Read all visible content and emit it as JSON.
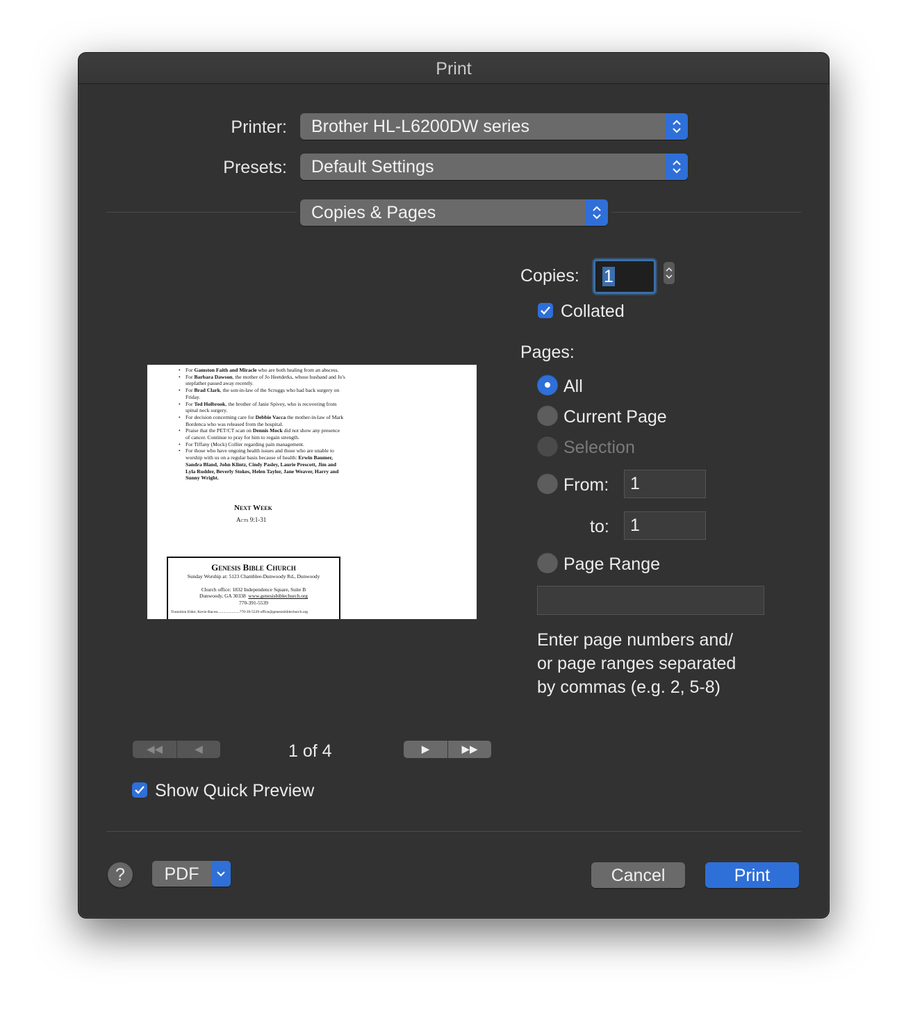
{
  "window": {
    "title": "Print"
  },
  "printer": {
    "label": "Printer:",
    "value": "Brother HL-L6200DW series"
  },
  "presets": {
    "label": "Presets:",
    "value": "Default Settings"
  },
  "section": {
    "value": "Copies & Pages"
  },
  "copies": {
    "label": "Copies:",
    "value": "1",
    "collated_label": "Collated",
    "collated_checked": true
  },
  "pages": {
    "label": "Pages:",
    "options": {
      "all": "All",
      "current": "Current Page",
      "selection": "Selection",
      "from": "From:",
      "page_range": "Page Range"
    },
    "selected": "All",
    "from_value": "1",
    "to_label": "to:",
    "to_value": "1",
    "range_value": "",
    "help_line1": "Enter page numbers and/",
    "help_line2": "or page ranges separated",
    "help_line3": "by commas (e.g. 2, 5-8)"
  },
  "preview": {
    "bullets": [
      {
        "pre": "For ",
        "bold": "Gamston Faith and Miracle",
        "post": " who are both healing from an abscess."
      },
      {
        "pre": "For ",
        "bold": "Barbara Dawson",
        "post": ", the mother of Jo Heetderks, whose husband and Jo's stepfather passed away recently."
      },
      {
        "pre": "For ",
        "bold": "Brad Clark",
        "post": ", the son-in-law of the Scruggs who had back surgery on Friday."
      },
      {
        "pre": "For ",
        "bold": "Ted Holbrook",
        "post": ", the brother of Janie Spivey, who is recovering from spinal neck surgery."
      },
      {
        "pre": "For decision concerning care for ",
        "bold": "Debbie Vacca",
        "post": " the mother-in-law of Mark Bordenca who was released from the hospital."
      },
      {
        "pre": "Praise that the PET/CT scan on ",
        "bold": "Dennis Mock",
        "post": " did not show any presence of cancer. Continue to pray for him to regain strength."
      },
      {
        "pre": "For Tiffany (Mock) Collier regarding pain management.",
        "bold": "",
        "post": ""
      },
      {
        "pre": "For those who have ongoing health issues and those who are unable to worship with us on a regular basis because of health: ",
        "bold": "Erwin Baumer, Sandra Bland, John Klintz, Cindy Pasley, Laurie Prescott, Jim and Lyla Rudder, Beverly Stokes, Helen Taylor, Jane Weaver, Harry and Sunny Wright.",
        "post": ""
      }
    ],
    "next_week": "Next Week",
    "acts": "Acts 9:1-31",
    "church_name": "Genesis Bible Church",
    "worship": "Sunday Worship at:  5123 Chamblee-Dunwoody Rd., Dunwoody",
    "office": "Church office:  1832 Independence Square, Suite B",
    "city": "Dunwoody, GA  30338",
    "website": "www.genesisbiblechurch.org",
    "phone": "770-391-5539",
    "staff": "Transition Elder, Kevin Bacon.......................770-39-5539 office@genesisbiblechurch.org"
  },
  "navigation": {
    "page_indicator": "1 of 4",
    "first": "◀◀",
    "prev": "◀",
    "next": "▶",
    "last": "▶▶"
  },
  "quick_preview": {
    "label": "Show Quick Preview",
    "checked": true
  },
  "footer": {
    "help": "?",
    "pdf": "PDF",
    "cancel": "Cancel",
    "print": "Print"
  },
  "colors": {
    "accent": "#2f6fd8",
    "window_bg": "#323232",
    "control_bg": "#6a6a6a"
  },
  "icons": [
    "up-down-chevron-icon",
    "checkmark-icon",
    "chevron-down-icon",
    "question-icon"
  ]
}
